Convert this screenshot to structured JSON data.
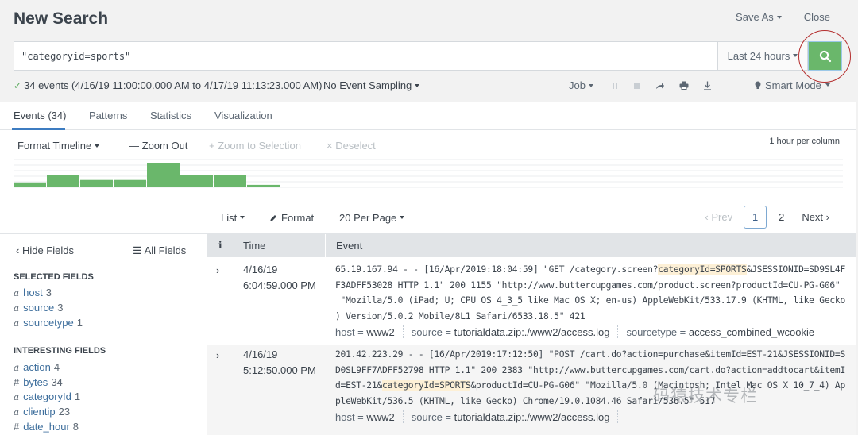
{
  "header": {
    "title": "New Search",
    "save_as": "Save As",
    "close": "Close"
  },
  "search": {
    "query": "\"categoryid=sports\"",
    "time_range": "Last 24 hours",
    "search_icon": "magnifier-icon"
  },
  "status": {
    "summary": "34 events (4/16/19 11:00:00.000 AM to 4/17/19 11:13:23.000 AM)",
    "sampling": "No Event Sampling",
    "job": "Job",
    "mode": "Smart Mode"
  },
  "tabs": [
    {
      "label": "Events (34)",
      "active": true
    },
    {
      "label": "Patterns",
      "active": false
    },
    {
      "label": "Statistics",
      "active": false
    },
    {
      "label": "Visualization",
      "active": false
    }
  ],
  "timeline": {
    "format": "Format Timeline",
    "zoom_out": "Zoom Out",
    "zoom_selection": "Zoom to Selection",
    "deselect": "Deselect",
    "per_column": "1 hour per column",
    "bar_color": "#6ab76b",
    "columns": 25,
    "counts": [
      2,
      5,
      3,
      3,
      10,
      5,
      5,
      1
    ]
  },
  "list_controls": {
    "list": "List",
    "format": "Format",
    "per_page": "20 Per Page",
    "prev": "Prev",
    "pages": [
      "1",
      "2"
    ],
    "current_page": "1",
    "next": "Next"
  },
  "fields": {
    "hide": "Hide Fields",
    "all": "All Fields",
    "selected_title": "SELECTED FIELDS",
    "selected": [
      {
        "type": "a",
        "name": "host",
        "count": "3"
      },
      {
        "type": "a",
        "name": "source",
        "count": "3"
      },
      {
        "type": "a",
        "name": "sourcetype",
        "count": "1"
      }
    ],
    "interesting_title": "INTERESTING FIELDS",
    "interesting": [
      {
        "type": "a",
        "name": "action",
        "count": "4"
      },
      {
        "type": "#",
        "name": "bytes",
        "count": "34"
      },
      {
        "type": "a",
        "name": "categoryId",
        "count": "1"
      },
      {
        "type": "a",
        "name": "clientip",
        "count": "23"
      },
      {
        "type": "#",
        "name": "date_hour",
        "count": "8"
      }
    ]
  },
  "table": {
    "headers": {
      "info": "i",
      "time": "Time",
      "event": "Event"
    },
    "events": [
      {
        "date": "4/16/19",
        "time": "6:04:59.000 PM",
        "lines": [
          [
            "65.19.167.94 - - [16/Apr/2019:18:04:59] \"GET /category.screen?",
            "categoryId=SPORTS",
            "&JSESSIONID=SD9SL4F"
          ],
          [
            "F3ADFF53028 HTTP 1.1\" 200 1155 \"http://www.buttercupgames.com/product.screen?productId=CU-PG-G06\""
          ],
          [
            " \"Mozilla/5.0 (iPad; U; CPU OS 4_3_5 like Mac OS X; en-us) AppleWebKit/533.17.9 (KHTML, like Gecko"
          ],
          [
            ") Version/5.0.2 Mobile/8L1 Safari/6533.18.5\" 421"
          ]
        ],
        "host": "www2",
        "source": "tutorialdata.zip:./www2/access.log",
        "sourcetype": "access_combined_wcookie"
      },
      {
        "date": "4/16/19",
        "time": "5:12:50.000 PM",
        "lines": [
          [
            "201.42.223.29 - - [16/Apr/2019:17:12:50] \"POST /cart.do?action=purchase&itemId=EST-21&JSESSIONID=S"
          ],
          [
            "D0SL9FF7ADFF52798 HTTP 1.1\" 200 2383 \"http://www.buttercupgames.com/cart.do?action=addtocart&itemI"
          ],
          [
            "d=EST-21&",
            "categoryId=SPORTS",
            "&productId=CU-PG-G06\" \"Mozilla/5.0 (Macintosh; Intel Mac OS X 10_7_4) Ap"
          ],
          [
            "pleWebKit/536.5 (KHTML, like Gecko) Chrome/19.0.1084.46 Safari/536.5\" 517"
          ]
        ],
        "host": "www2",
        "source": "tutorialdata.zip:./www2/access.log"
      }
    ],
    "labels": {
      "host": "host = ",
      "source": "source = ",
      "sourcetype": "sourcetype = "
    }
  },
  "watermark": "码猿技术专栏",
  "colors": {
    "accent": "#3d7cc1",
    "search_button": "#6ab76b",
    "highlight": "#fdf0d6",
    "annotation_circle": "#b42e2e"
  }
}
